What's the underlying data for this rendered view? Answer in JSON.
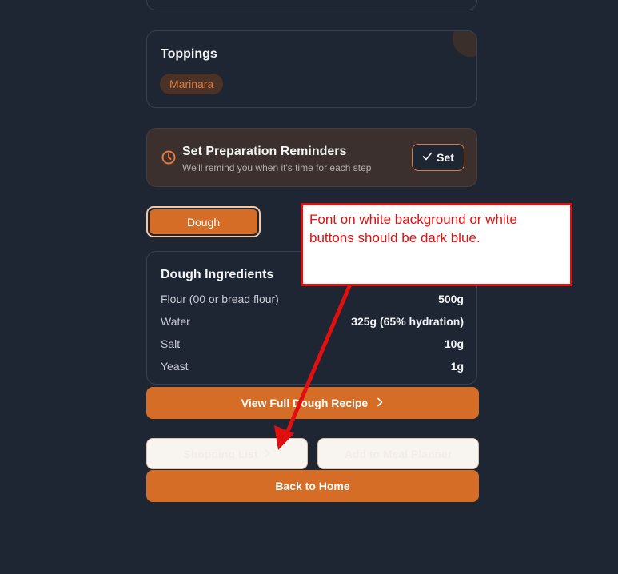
{
  "toppings": {
    "title": "Toppings",
    "chips": [
      "Marinara"
    ]
  },
  "reminder": {
    "title": "Set Preparation Reminders",
    "subtitle": "We'll remind you when it's time for each step",
    "set_label": "Set"
  },
  "tabs": [
    {
      "label": "Dough",
      "active": true
    }
  ],
  "ingredients": {
    "title": "Dough Ingredients",
    "items": [
      {
        "name": "Flour (00 or bread flour)",
        "value": "500g"
      },
      {
        "name": "Water",
        "value": "325g (65% hydration)"
      },
      {
        "name": "Salt",
        "value": "10g"
      },
      {
        "name": "Yeast",
        "value": "1g"
      }
    ]
  },
  "actions": {
    "view_recipe": "View Full Dough Recipe",
    "shopping_list": "Shopping List",
    "meal_planner": "Add to Meal Planner",
    "back_home": "Back to Home"
  },
  "annotation": {
    "text": "Font on white background or white buttons should be dark blue."
  },
  "colors": {
    "background": "#1e2533",
    "accent": "#d56d27",
    "annotation": "#e01010"
  },
  "icons": {
    "clock": "clock-icon",
    "check": "check-icon",
    "chevron": "chevron-right-icon",
    "arrow": "arrow-icon"
  }
}
